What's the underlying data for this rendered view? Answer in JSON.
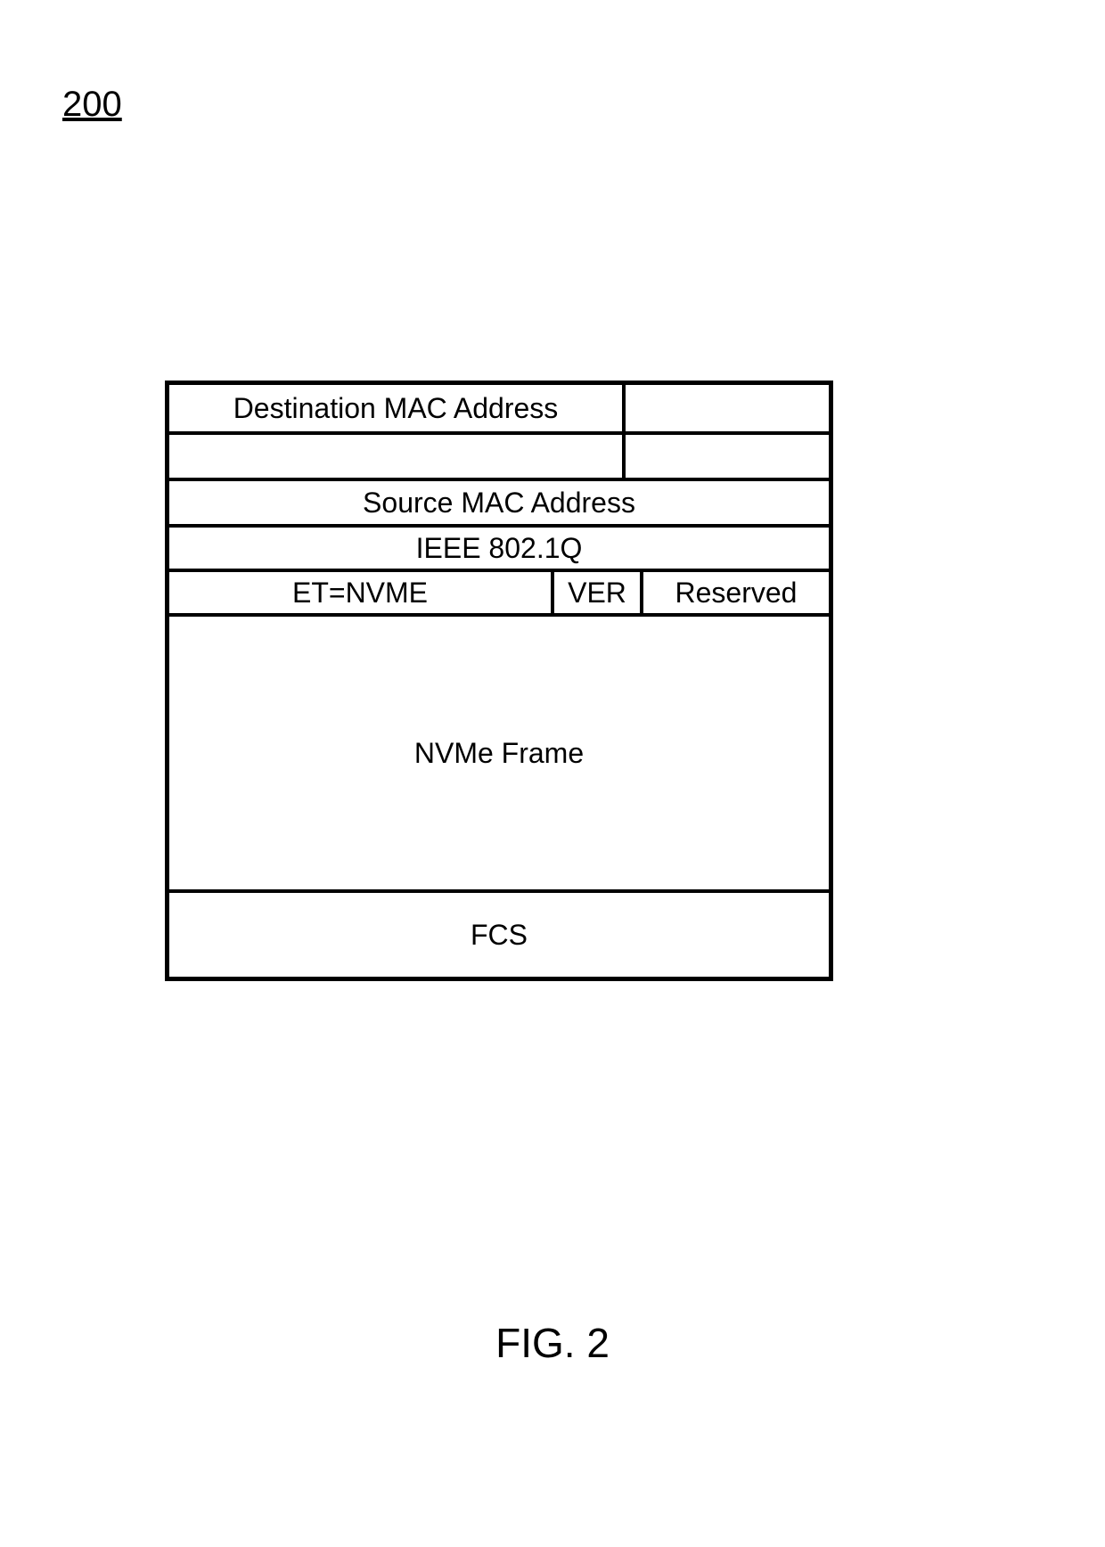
{
  "figure_number": "200",
  "frame": {
    "dest_mac": "Destination MAC Address",
    "source_mac": "Source MAC Address",
    "ieee": "IEEE 802.1Q",
    "et": "ET=NVME",
    "ver": "VER",
    "reserved": "Reserved",
    "nvme": "NVMe Frame",
    "fcs": "FCS"
  },
  "caption": "FIG. 2"
}
